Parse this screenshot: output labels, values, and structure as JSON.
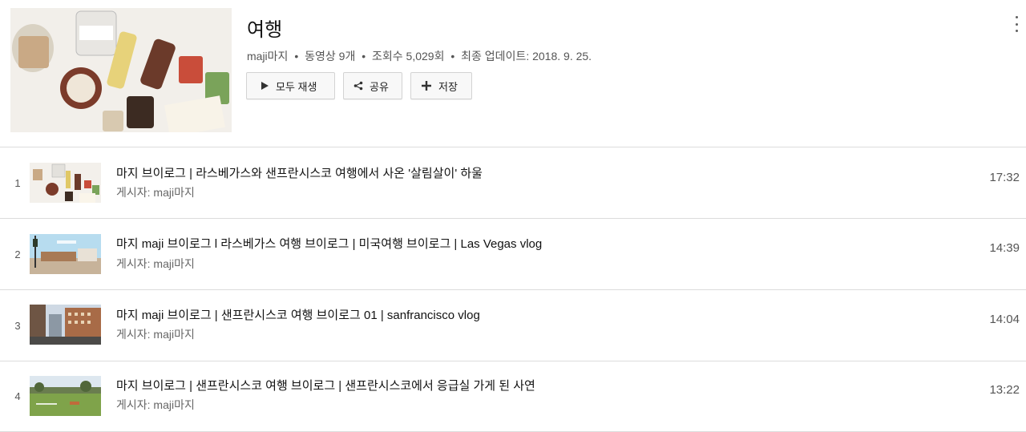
{
  "playlist": {
    "title": "여행",
    "owner": "maji마지",
    "video_count": "동영상 9개",
    "views": "조회수 5,029회",
    "updated": "최종 업데이트: 2018. 9. 25.",
    "separator": "•"
  },
  "actions": {
    "play_all": "모두 재생",
    "share": "공유",
    "save": "저장"
  },
  "videos": [
    {
      "index": "1",
      "title": "마지 브이로그 | 라스베가스와 샌프란시스코 여행에서 사온 '살림살이' 하울",
      "owner": "게시자: maji마지",
      "duration": "17:32"
    },
    {
      "index": "2",
      "title": "마지 maji 브이로그 l 라스베가스 여행 브이로그 |  미국여행 브이로그 | Las Vegas vlog",
      "owner": "게시자: maji마지",
      "duration": "14:39"
    },
    {
      "index": "3",
      "title": "마지 maji 브이로그  |  샌프란시스코 여행 브이로그 01  |  sanfrancisco vlog",
      "owner": "게시자: maji마지",
      "duration": "14:04"
    },
    {
      "index": "4",
      "title": "마지 브이로그  |  샌프란시스코 여행 브이로그  |  샌프란시스코에서 응급실 가게 된 사연",
      "owner": "게시자: maji마지",
      "duration": "13:22"
    }
  ],
  "icons": {
    "play": "play-icon",
    "share": "share-icon",
    "save": "plus-icon",
    "more": "more-vert-icon"
  }
}
